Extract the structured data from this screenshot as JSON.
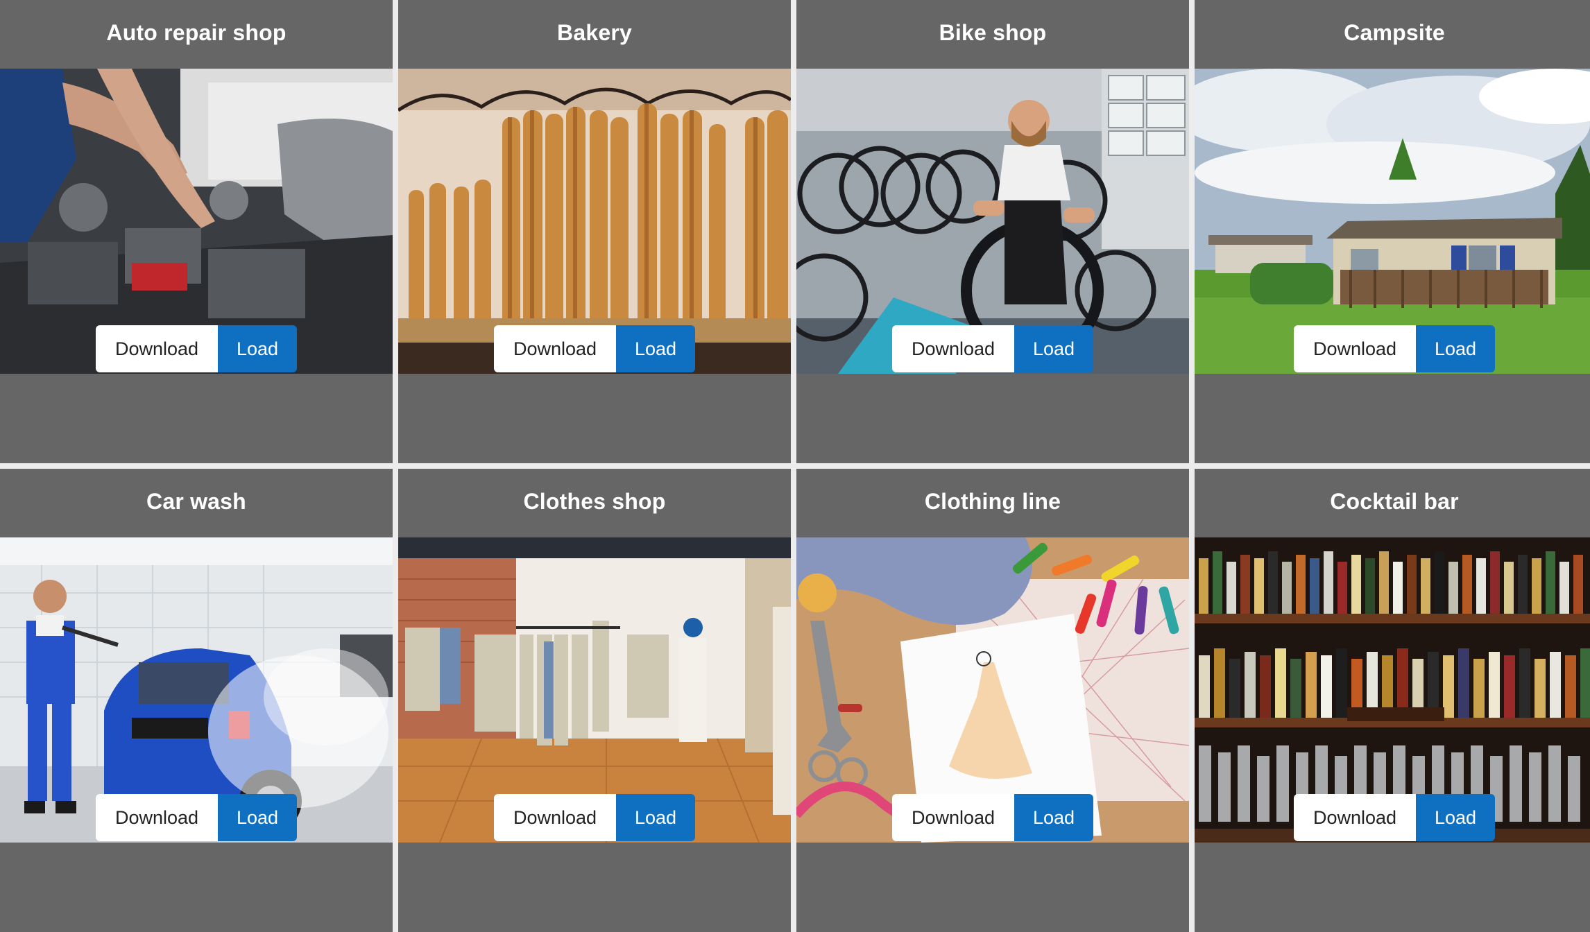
{
  "buttons": {
    "download_label": "Download",
    "load_label": "Load"
  },
  "colors": {
    "card_background": "#666666",
    "gap_background": "#ececec",
    "load_button": "#0f70c2",
    "download_button": "#ffffff"
  },
  "cards": [
    {
      "title": "Auto repair shop",
      "image": "mechanic-engine-photo"
    },
    {
      "title": "Bakery",
      "image": "baguettes-photo"
    },
    {
      "title": "Bike shop",
      "image": "bike-mechanic-photo"
    },
    {
      "title": "Campsite",
      "image": "mobile-home-photo"
    },
    {
      "title": "Car wash",
      "image": "car-wash-photo"
    },
    {
      "title": "Clothes shop",
      "image": "clothing-store-photo"
    },
    {
      "title": "Clothing line",
      "image": "fashion-sketch-photo"
    },
    {
      "title": "Cocktail bar",
      "image": "bar-shelves-photo"
    }
  ]
}
